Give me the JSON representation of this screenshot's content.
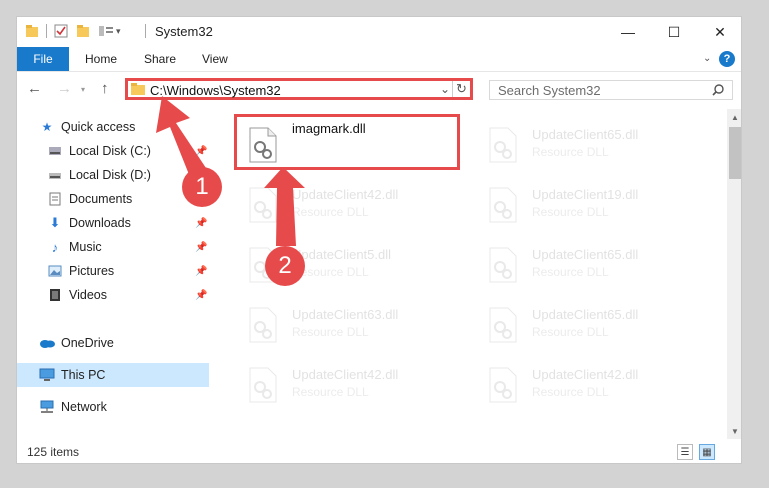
{
  "window": {
    "title": "System32",
    "controls": {
      "minimize": "—",
      "maximize": "☐",
      "close": "✕"
    }
  },
  "ribbon": {
    "tabs": [
      "File",
      "Home",
      "Share",
      "View"
    ],
    "help": "?"
  },
  "navigation": {
    "address": "C:\\Windows\\System32",
    "search_placeholder": "Search System32"
  },
  "sidebar": {
    "items": [
      {
        "label": "Quick access",
        "icon": "star-icon"
      },
      {
        "label": "Local Disk (C:)",
        "icon": "drive-icon"
      },
      {
        "label": "Local Disk (D:)",
        "icon": "drive-icon"
      },
      {
        "label": "Documents",
        "icon": "document-icon"
      },
      {
        "label": "Downloads",
        "icon": "download-icon"
      },
      {
        "label": "Music",
        "icon": "music-icon"
      },
      {
        "label": "Pictures",
        "icon": "picture-icon"
      },
      {
        "label": "Videos",
        "icon": "video-icon"
      },
      {
        "label": "OneDrive",
        "icon": "cloud-icon"
      },
      {
        "label": "This PC",
        "icon": "computer-icon"
      },
      {
        "label": "Network",
        "icon": "network-icon"
      }
    ]
  },
  "files": [
    {
      "name": "imagmark.dll",
      "desc": ""
    },
    {
      "name": "UpdateClient65.dll",
      "desc": "Resource DLL"
    },
    {
      "name": "UpdateClient42.dll",
      "desc": "Resource DLL"
    },
    {
      "name": "UpdateClient19.dll",
      "desc": "Resource DLL"
    },
    {
      "name": "UpdateClient5.dll",
      "desc": "Resource DLL"
    },
    {
      "name": "UpdateClient65.dll",
      "desc": "Resource DLL"
    },
    {
      "name": "UpdateClient63.dll",
      "desc": "Resource DLL"
    },
    {
      "name": "UpdateClient65.dll",
      "desc": "Resource DLL"
    },
    {
      "name": "UpdateClient42.dll",
      "desc": "Resource DLL"
    },
    {
      "name": "UpdateClient42.dll",
      "desc": "Resource DLL"
    }
  ],
  "status": {
    "count": "125 items"
  },
  "annotations": {
    "step1": "1",
    "step2": "2"
  },
  "colors": {
    "accent": "#1979ca",
    "highlight": "#e74a4a",
    "selected": "#cce8ff"
  }
}
